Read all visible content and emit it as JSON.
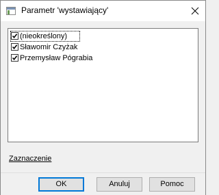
{
  "window": {
    "title": "Parametr 'wystawiający'"
  },
  "list": {
    "items": [
      {
        "label": "(nieokreślony)",
        "checked": true
      },
      {
        "label": "Sławomir Czyżak",
        "checked": true
      },
      {
        "label": "Przemysław Pógrabia",
        "checked": true
      }
    ]
  },
  "links": {
    "selection": "Zaznaczenie"
  },
  "buttons": {
    "ok": "OK",
    "cancel": "Anuluj",
    "help": "Pomoc"
  },
  "colors": {
    "default_button_border": "#0078d7",
    "titlebar": "#ffffff",
    "dialog_background": "#f0f0f0"
  }
}
